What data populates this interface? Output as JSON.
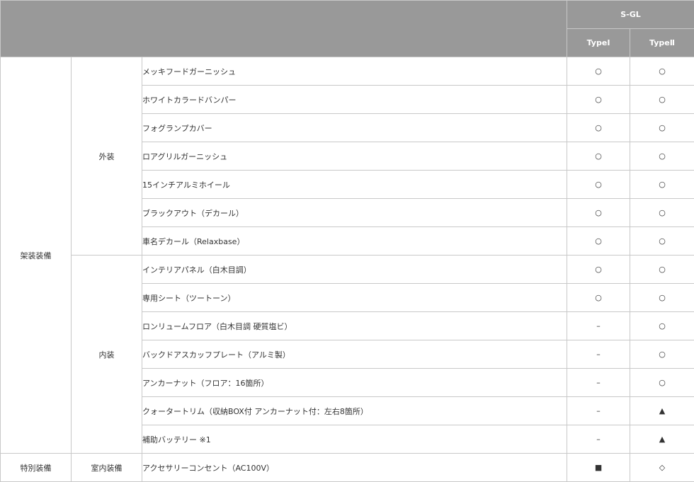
{
  "header": {
    "model": "S-GL",
    "type1": "TypeⅠ",
    "type2": "TypeⅡ"
  },
  "groups": {
    "kasou": "架装装備",
    "gaisou": "外装",
    "naisou": "内装",
    "tokubetsu": "特別装備",
    "shitsunai": "室内装備"
  },
  "rows": [
    {
      "name": "メッキフードガーニッシュ",
      "t1": "○",
      "t2": "○"
    },
    {
      "name": "ホワイトカラードバンパー",
      "t1": "○",
      "t2": "○"
    },
    {
      "name": "フォグランプカバー",
      "t1": "○",
      "t2": "○"
    },
    {
      "name": "ロアグリルガーニッシュ",
      "t1": "○",
      "t2": "○"
    },
    {
      "name": "15インチアルミホイール",
      "t1": "○",
      "t2": "○"
    },
    {
      "name": "ブラックアウト（デカール）",
      "t1": "○",
      "t2": "○"
    },
    {
      "name": "車名デカール（Relaxbase）",
      "t1": "○",
      "t2": "○"
    },
    {
      "name": "インテリアパネル（白木目調）",
      "t1": "○",
      "t2": "○"
    },
    {
      "name": "専用シート（ツートーン）",
      "t1": "○",
      "t2": "○"
    },
    {
      "name": "ロンリュームフロア（白木目調 硬質塩ビ）",
      "t1": "–",
      "t2": "○"
    },
    {
      "name": "バックドアスカッフプレート（アルミ製）",
      "t1": "–",
      "t2": "○"
    },
    {
      "name": "アンカーナット（フロア：16箇所）",
      "t1": "–",
      "t2": "○"
    },
    {
      "name": "クォータートリム（収納BOX付 アンカーナット付：左右8箇所）",
      "t1": "–",
      "t2": "▲"
    },
    {
      "name": "補助バッテリー ※1",
      "t1": "–",
      "t2": "▲"
    },
    {
      "name": "アクセサリーコンセント（AC100V）",
      "t1": "■",
      "t2": "◇"
    }
  ]
}
